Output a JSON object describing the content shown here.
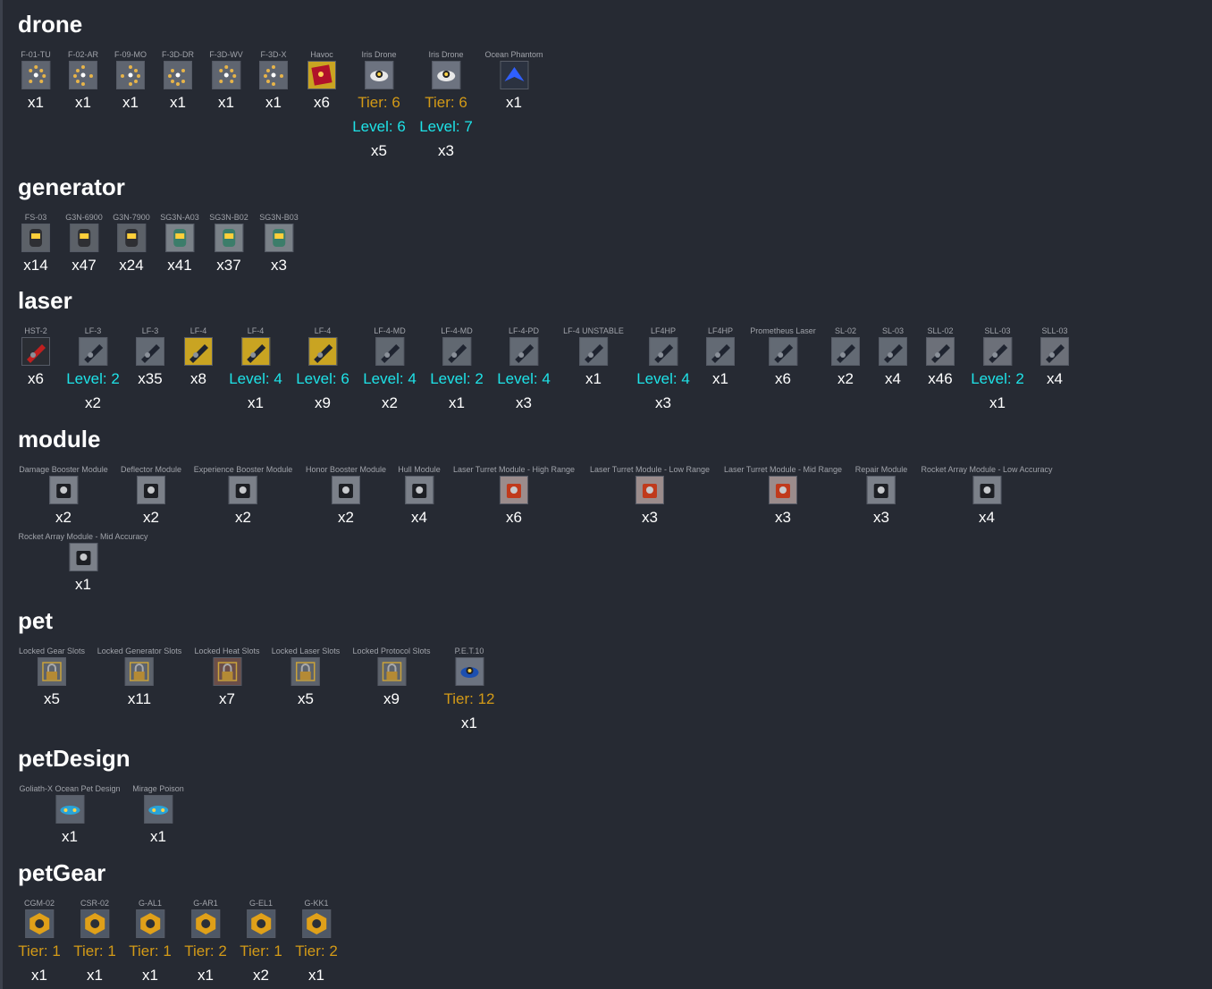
{
  "sections": [
    {
      "title": "drone",
      "items": [
        {
          "name": "F-01-TU",
          "count": "x1",
          "icon": "drone-formation-icon"
        },
        {
          "name": "F-02-AR",
          "count": "x1",
          "icon": "drone-formation-icon"
        },
        {
          "name": "F-09-MO",
          "count": "x1",
          "icon": "drone-formation-icon"
        },
        {
          "name": "F-3D-DR",
          "count": "x1",
          "icon": "drone-formation-icon"
        },
        {
          "name": "F-3D-WV",
          "count": "x1",
          "icon": "drone-formation-icon"
        },
        {
          "name": "F-3D-X",
          "count": "x1",
          "icon": "drone-formation-icon"
        },
        {
          "name": "Havoc",
          "count": "x6",
          "icon": "havoc-design-icon"
        },
        {
          "name": "Iris Drone",
          "tier": "Tier: 6",
          "level": "Level: 6",
          "count": "x5",
          "icon": "iris-drone-icon"
        },
        {
          "name": "Iris Drone",
          "tier": "Tier: 6",
          "level": "Level: 7",
          "count": "x3",
          "icon": "iris-drone-icon"
        },
        {
          "name": "Ocean Phantom",
          "count": "x1",
          "icon": "ocean-phantom-icon"
        }
      ]
    },
    {
      "title": "generator",
      "items": [
        {
          "name": "FS-03",
          "count": "x14",
          "icon": "generator-icon"
        },
        {
          "name": "G3N-6900",
          "count": "x47",
          "icon": "generator-icon"
        },
        {
          "name": "G3N-7900",
          "count": "x24",
          "icon": "generator-icon"
        },
        {
          "name": "SG3N-A03",
          "count": "x41",
          "icon": "shield-generator-icon"
        },
        {
          "name": "SG3N-B02",
          "count": "x37",
          "icon": "shield-generator-icon"
        },
        {
          "name": "SG3N-B03",
          "count": "x3",
          "icon": "shield-generator-icon"
        }
      ]
    },
    {
      "title": "laser",
      "items": [
        {
          "name": "HST-2",
          "count": "x6",
          "icon": "rocket-launcher-icon"
        },
        {
          "name": "LF-3",
          "level": "Level: 2",
          "count": "x2",
          "icon": "laser-icon"
        },
        {
          "name": "LF-3",
          "count": "x35",
          "icon": "laser-icon"
        },
        {
          "name": "LF-4",
          "count": "x8",
          "icon": "laser-icon"
        },
        {
          "name": "LF-4",
          "level": "Level: 4",
          "count": "x1",
          "icon": "laser-icon"
        },
        {
          "name": "LF-4",
          "level": "Level: 6",
          "count": "x9",
          "icon": "laser-icon"
        },
        {
          "name": "LF-4-MD",
          "level": "Level: 4",
          "count": "x2",
          "icon": "laser-icon"
        },
        {
          "name": "LF-4-MD",
          "level": "Level: 2",
          "count": "x1",
          "icon": "laser-icon"
        },
        {
          "name": "LF-4-PD",
          "level": "Level: 4",
          "count": "x3",
          "icon": "laser-icon"
        },
        {
          "name": "LF-4 UNSTABLE",
          "count": "x1",
          "icon": "laser-icon"
        },
        {
          "name": "LF4HP",
          "level": "Level: 4",
          "count": "x3",
          "icon": "laser-icon"
        },
        {
          "name": "LF4HP",
          "count": "x1",
          "icon": "laser-icon"
        },
        {
          "name": "Prometheus Laser",
          "count": "x6",
          "icon": "laser-icon"
        },
        {
          "name": "SL-02",
          "count": "x2",
          "icon": "laser-icon"
        },
        {
          "name": "SL-03",
          "count": "x4",
          "icon": "laser-icon"
        },
        {
          "name": "SLL-02",
          "count": "x46",
          "icon": "laser-icon"
        },
        {
          "name": "SLL-03",
          "level": "Level: 2",
          "count": "x1",
          "icon": "laser-icon"
        },
        {
          "name": "SLL-03",
          "count": "x4",
          "icon": "laser-icon"
        }
      ]
    },
    {
      "title": "module",
      "items": [
        {
          "name": "Damage Booster Module",
          "count": "x2",
          "icon": "module-icon"
        },
        {
          "name": "Deflector Module",
          "count": "x2",
          "icon": "module-icon"
        },
        {
          "name": "Experience Booster Module",
          "count": "x2",
          "icon": "module-icon"
        },
        {
          "name": "Honor Booster Module",
          "count": "x2",
          "icon": "module-icon"
        },
        {
          "name": "Hull Module",
          "count": "x4",
          "icon": "module-icon"
        },
        {
          "name": "Laser Turret Module - High Range",
          "count": "x6",
          "icon": "turret-module-icon"
        },
        {
          "name": "Laser Turret Module - Low Range",
          "count": "x3",
          "icon": "turret-module-icon"
        },
        {
          "name": "Laser Turret Module - Mid Range",
          "count": "x3",
          "icon": "turret-module-icon"
        },
        {
          "name": "Repair Module",
          "count": "x3",
          "icon": "module-icon"
        },
        {
          "name": "Rocket Array Module - Low Accuracy",
          "count": "x4",
          "icon": "module-icon"
        },
        {
          "name": "Rocket Array Module - Mid Accuracy",
          "count": "x1",
          "icon": "module-icon"
        }
      ]
    },
    {
      "title": "pet",
      "items": [
        {
          "name": "Locked Gear Slots",
          "count": "x5",
          "icon": "lock-icon"
        },
        {
          "name": "Locked Generator Slots",
          "count": "x11",
          "icon": "lock-icon"
        },
        {
          "name": "Locked Heat Slots",
          "count": "x7",
          "icon": "lock-icon"
        },
        {
          "name": "Locked Laser Slots",
          "count": "x5",
          "icon": "lock-icon"
        },
        {
          "name": "Locked Protocol Slots",
          "count": "x9",
          "icon": "lock-icon"
        },
        {
          "name": "P.E.T.10",
          "tier": "Tier: 12",
          "count": "x1",
          "icon": "pet-icon"
        }
      ]
    },
    {
      "title": "petDesign",
      "items": [
        {
          "name": "Goliath-X Ocean Pet Design",
          "count": "x1",
          "icon": "pet-design-icon"
        },
        {
          "name": "Mirage Poison",
          "count": "x1",
          "icon": "pet-design-icon"
        }
      ]
    },
    {
      "title": "petGear",
      "items": [
        {
          "name": "CGM-02",
          "tier": "Tier: 1",
          "count": "x1",
          "icon": "pet-gear-icon"
        },
        {
          "name": "CSR-02",
          "tier": "Tier: 1",
          "count": "x1",
          "icon": "pet-gear-icon"
        },
        {
          "name": "G-AL1",
          "tier": "Tier: 1",
          "count": "x1",
          "icon": "pet-gear-icon"
        },
        {
          "name": "G-AR1",
          "tier": "Tier: 2",
          "count": "x1",
          "icon": "pet-gear-icon"
        },
        {
          "name": "G-EL1",
          "tier": "Tier: 1",
          "count": "x2",
          "icon": "pet-gear-icon"
        },
        {
          "name": "G-KK1",
          "tier": "Tier: 2",
          "count": "x1",
          "icon": "pet-gear-icon"
        }
      ]
    }
  ],
  "colors": {
    "background": "#262a33",
    "tier": "#d39a17",
    "level": "#1ee3e8",
    "count": "#ffffff",
    "name": "#a0a3aa"
  }
}
